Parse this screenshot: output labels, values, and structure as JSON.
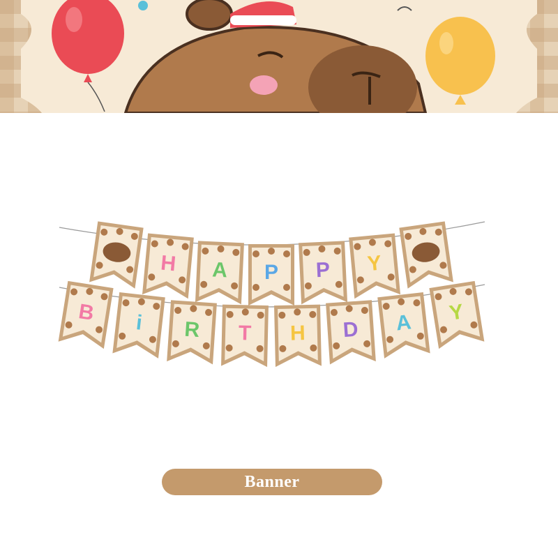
{
  "hero": {
    "description_icons": [
      "red-balloon-icon",
      "yellow-balloon-icon",
      "capybara-party-hat-icon"
    ],
    "colors": {
      "plaid_light": "#e6d2b6",
      "plaid_dark": "#c9a57c",
      "cream": "#f7ead6",
      "capybara_fur": "#b07a4c",
      "capybara_snout": "#8a5a36",
      "cheek": "#f4a3b6",
      "balloon_red": "#ea4b55",
      "balloon_yellow": "#f8c14e"
    }
  },
  "banner": {
    "row1_letters": [
      "",
      "H",
      "A",
      "P",
      "P",
      "Y",
      ""
    ],
    "row2_letters": [
      "B",
      "i",
      "R",
      "T",
      "H",
      "D",
      "A",
      "Y"
    ],
    "row1_colors": [
      "#000000",
      "#f27aa5",
      "#6cc66a",
      "#5aa7e6",
      "#9b6fd3",
      "#f5c542",
      "#000000"
    ],
    "row2_colors": [
      "#f27aa5",
      "#5ac0d9",
      "#6cc66a",
      "#f27aa5",
      "#f5c542",
      "#9b6fd3",
      "#5ac0d9",
      "#b6d845"
    ],
    "colors": {
      "border": "#c9a57c",
      "card": "#f7ead6",
      "string": "#9a9a9a"
    }
  },
  "label": {
    "text": "Banner",
    "pill_color": "#c49a6c"
  }
}
